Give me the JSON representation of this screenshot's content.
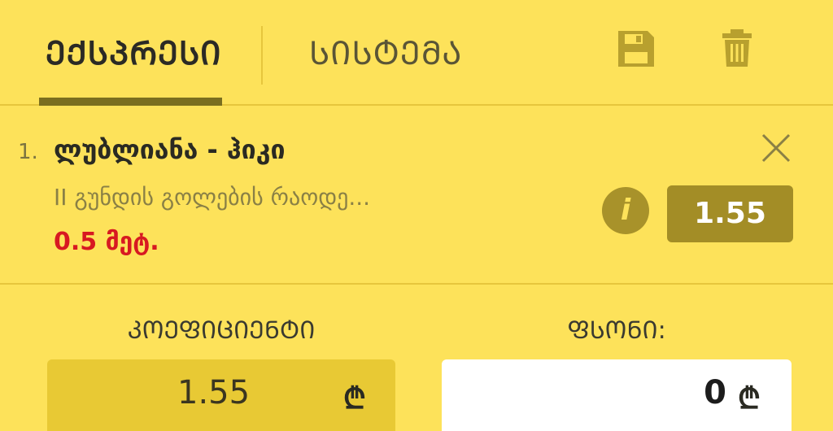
{
  "tabs": [
    {
      "label": "ᲔᲥᲡᲞᲠᲔᲡᲘ",
      "active": true
    },
    {
      "label": "ᲡᲘᲡᲢᲔᲛᲐ",
      "active": false
    }
  ],
  "icons": {
    "save": "save-icon",
    "trash": "trash-icon",
    "close": "close-icon",
    "info": "info-icon"
  },
  "bet": {
    "number": "1.",
    "match": "ლუბლიანა - ჰიკი",
    "market": "II გუნდის გოლების რაოდე...",
    "selection": "0.5 მეტ.",
    "odds": "1.55",
    "info_glyph": "i"
  },
  "summary": {
    "coefficient_label": "ᲙᲝᲔᲤᲘᲪᲘᲔᲜᲢᲘ",
    "coefficient_value": "1.55",
    "stake_label": "ᲤᲡᲝᲜᲘ:",
    "stake_value": "0",
    "currency": "₾"
  },
  "colors": {
    "background": "#fde25a",
    "accent": "#a38d26",
    "selection": "#d71921"
  }
}
